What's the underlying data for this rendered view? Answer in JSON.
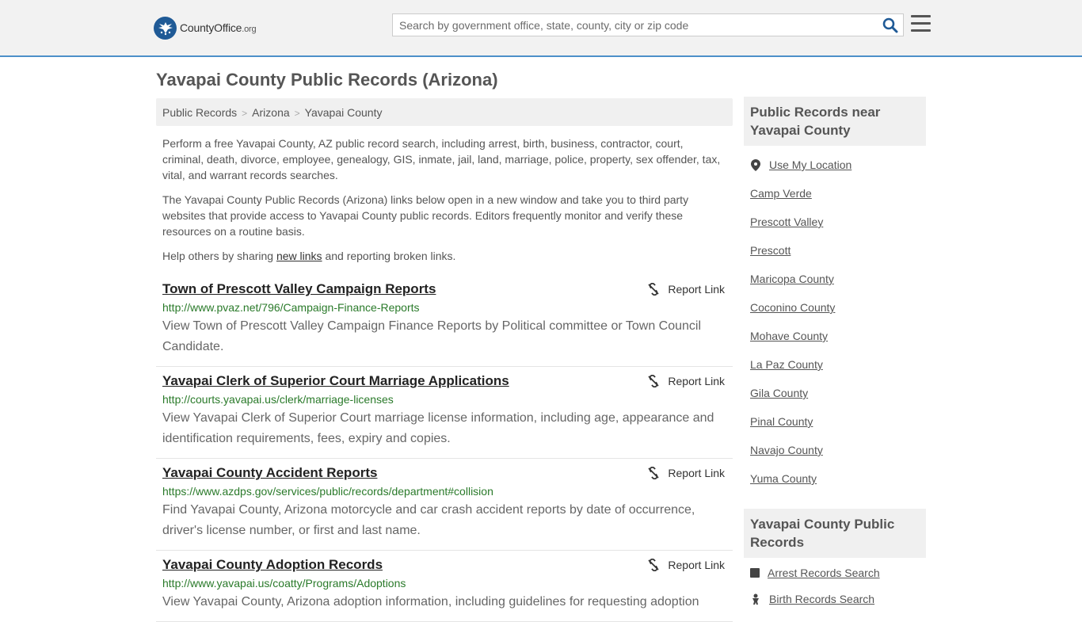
{
  "header": {
    "logo_name": "CountyOffice",
    "logo_tld": ".org",
    "search_placeholder": "Search by government office, state, county, city or zip code"
  },
  "page": {
    "title": "Yavapai County Public Records (Arizona)"
  },
  "breadcrumb": [
    "Public Records",
    "Arizona",
    "Yavapai County"
  ],
  "intro": {
    "p1": "Perform a free Yavapai County, AZ public record search, including arrest, birth, business, contractor, court, criminal, death, divorce, employee, genealogy, GIS, inmate, jail, land, marriage, police, property, sex offender, tax, vital, and warrant records searches.",
    "p2": "The Yavapai County Public Records (Arizona) links below open in a new window and take you to third party websites that provide access to Yavapai County public records. Editors frequently monitor and verify these resources on a routine basis.",
    "p3_before": "Help others by sharing ",
    "p3_link": "new links",
    "p3_after": " and reporting broken links."
  },
  "report_label": "Report Link",
  "records": [
    {
      "title": "Town of Prescott Valley Campaign Reports",
      "url": "http://www.pvaz.net/796/Campaign-Finance-Reports",
      "desc": "View Town of Prescott Valley Campaign Finance Reports by Political committee or Town Council Candidate."
    },
    {
      "title": "Yavapai Clerk of Superior Court Marriage Applications",
      "url": "http://courts.yavapai.us/clerk/marriage-licenses",
      "desc": "View Yavapai Clerk of Superior Court marriage license information, including age, appearance and identification requirements, fees, expiry and copies."
    },
    {
      "title": "Yavapai County Accident Reports",
      "url": "https://www.azdps.gov/services/public/records/department#collision",
      "desc": "Find Yavapai County, Arizona motorcycle and car crash accident reports by date of occurrence, driver's license number, or first and last name."
    },
    {
      "title": "Yavapai County Adoption Records",
      "url": "http://www.yavapai.us/coatty/Programs/Adoptions",
      "desc": "View Yavapai County, Arizona adoption information, including guidelines for requesting adoption"
    }
  ],
  "sidebar": {
    "nearby_heading": "Public Records near Yavapai County",
    "use_location": "Use My Location",
    "nearby": [
      "Camp Verde",
      "Prescott Valley",
      "Prescott",
      "Maricopa County",
      "Coconino County",
      "Mohave County",
      "La Paz County",
      "Gila County",
      "Pinal County",
      "Navajo County",
      "Yuma County"
    ],
    "records_heading": "Yavapai County Public Records",
    "record_links": [
      "Arrest Records Search",
      "Birth Records Search"
    ]
  }
}
